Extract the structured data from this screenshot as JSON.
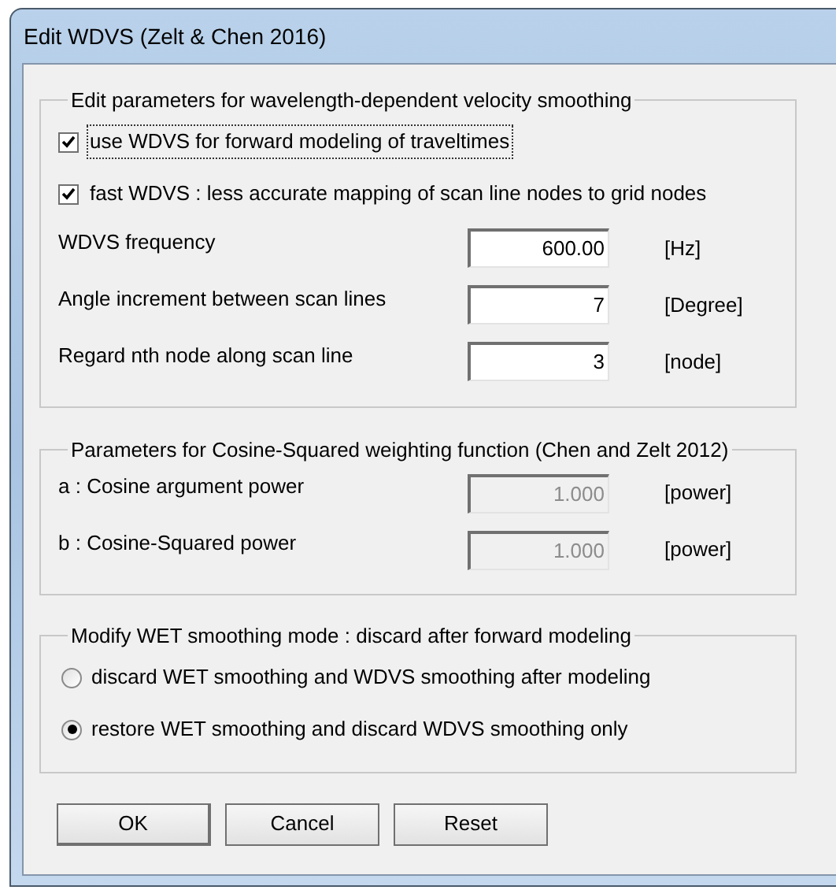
{
  "window": {
    "title": "Edit WDVS (Zelt & Chen 2016)"
  },
  "groups": [
    {
      "title": "Edit parameters for wavelength-dependent velocity smoothing",
      "items": [
        {
          "kind": "checkbox",
          "label": "use WDVS for forward modeling of traveltimes",
          "checked": true,
          "focused": true
        },
        {
          "kind": "checkbox",
          "label": "fast WDVS : less accurate mapping of scan line nodes to grid nodes",
          "checked": true,
          "focused": false
        },
        {
          "kind": "field",
          "label": "WDVS frequency",
          "value": "600.00",
          "unit": "[Hz]",
          "disabled": false
        },
        {
          "kind": "field",
          "label": "Angle increment between scan lines",
          "value": "7",
          "unit": "[Degree]",
          "disabled": false
        },
        {
          "kind": "field",
          "label": "Regard nth node along scan line",
          "value": "3",
          "unit": "[node]",
          "disabled": false
        }
      ]
    },
    {
      "title": "Parameters for Cosine-Squared weighting function (Chen and Zelt 2012)",
      "items": [
        {
          "kind": "field",
          "label": "a : Cosine argument power",
          "value": "1.000",
          "unit": "[power]",
          "disabled": true
        },
        {
          "kind": "field",
          "label": "b : Cosine-Squared power",
          "value": "1.000",
          "unit": "[power]",
          "disabled": true
        }
      ]
    },
    {
      "title": "Modify WET smoothing mode : discard after forward modeling",
      "items": [
        {
          "kind": "radio",
          "label": "discard WET smoothing and WDVS smoothing after modeling",
          "selected": false
        },
        {
          "kind": "radio",
          "label": "restore WET smoothing and discard WDVS smoothing only",
          "selected": true
        }
      ]
    }
  ],
  "buttons": [
    "OK",
    "Cancel",
    "Reset"
  ]
}
